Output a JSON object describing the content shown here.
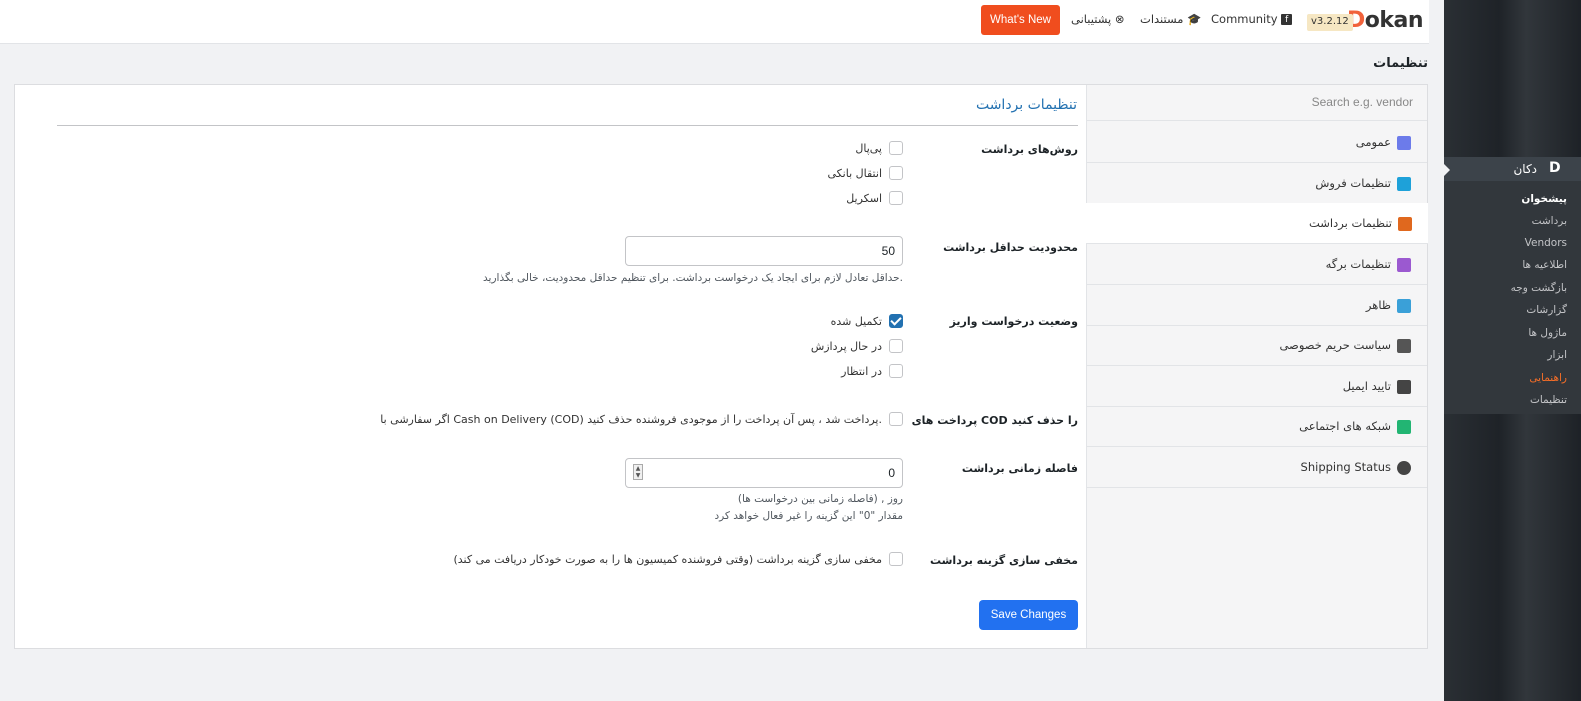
{
  "header": {
    "logo_text": "Dokan",
    "version": "v3.2.12",
    "community_label": "Community",
    "docs_label": "مستندات",
    "support_label": "پشتیبانی",
    "whats_new_label": "What's New"
  },
  "page_title": "تنظیمات",
  "admin_menu": {
    "title": "دکان",
    "items": [
      "پیشخوان",
      "برداشت",
      "Vendors",
      "اطلاعیه ها",
      "بازگشت وجه",
      "گزارشات",
      "ماژول ها",
      "ابزار",
      "راهنمایی",
      "تنظیمات"
    ],
    "active_item": "راهنمایی"
  },
  "tabs": {
    "search_placeholder": "Search e.g. vendor",
    "items": [
      {
        "label": "عمومی",
        "icon": "gear-icon",
        "color": "#6c7bea"
      },
      {
        "label": "تنظیمات فروش",
        "icon": "cart-icon",
        "color": "#1ea1d9"
      },
      {
        "label": "تنظیمات برداشت",
        "icon": "withdraw-icon",
        "color": "#e0681e"
      },
      {
        "label": "تنظیمات برگه",
        "icon": "page-icon",
        "color": "#9b59d0"
      },
      {
        "label": "ظاهر",
        "icon": "brush-icon",
        "color": "#3aa0d8"
      },
      {
        "label": "سیاست حریم خصوصی",
        "icon": "key-icon",
        "color": "#555555"
      },
      {
        "label": "تایید ایمیل",
        "icon": "shield-icon",
        "color": "#444444"
      },
      {
        "label": "شبکه های اجتماعی",
        "icon": "network-icon",
        "color": "#22b573"
      },
      {
        "label": "Shipping Status",
        "icon": "globe-icon",
        "color": "#444444"
      }
    ],
    "active_index": 2
  },
  "form": {
    "section_title": "تنظیمات برداشت",
    "methods": {
      "label": "روش‌های برداشت",
      "options": [
        {
          "label": "پی‌پال",
          "checked": false
        },
        {
          "label": "انتقال بانکی",
          "checked": false
        },
        {
          "label": "اسکریل",
          "checked": false
        }
      ]
    },
    "min_limit": {
      "label": "محدودیت حداقل برداشت",
      "value": "50",
      "help": "حداقل تعادل لازم برای ایجاد یک درخواست برداشت. برای تنظیم حداقل محدودیت، خالی بگذارید."
    },
    "status": {
      "label": "وضعیت درخواست واریز",
      "options": [
        {
          "label": "تکمیل شده",
          "checked": true
        },
        {
          "label": "در حال پردازش",
          "checked": false
        },
        {
          "label": "در انتظار",
          "checked": false
        }
      ]
    },
    "cod": {
      "label": "پرداخت های COD را حذف کنید",
      "text": "اگر سفارشی با Cash on Delivery (COD) پرداخت شد ، پس آن پرداخت را از موجودی فروشنده حذف کنید.",
      "checked": false
    },
    "interval": {
      "label": "فاصله زمانی برداشت",
      "value": "0",
      "help1": "روز , (فاصله زمانی بین درخواست ها)",
      "help2": "مقدار \"0\" این گزینه را غیر فعال خواهد کرد"
    },
    "hide": {
      "label": "مخفی سازی گزینه برداشت",
      "text": "مخفی سازی گزینه برداشت (وقتی فروشنده کمیسیون ها را به صورت خودکار دریافت می کند)",
      "checked": false
    },
    "save_label": "Save Changes"
  }
}
